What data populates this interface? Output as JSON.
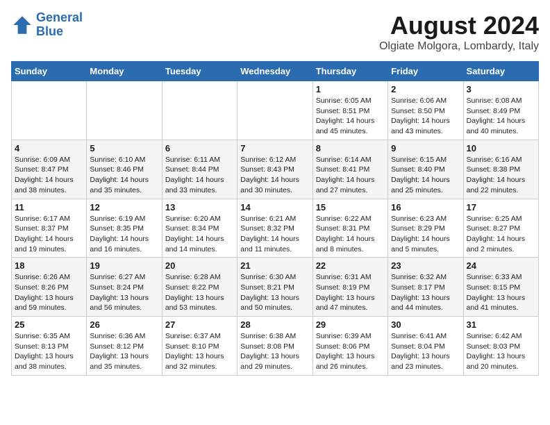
{
  "header": {
    "logo_line1": "General",
    "logo_line2": "Blue",
    "title": "August 2024",
    "subtitle": "Olgiate Molgora, Lombardy, Italy"
  },
  "weekdays": [
    "Sunday",
    "Monday",
    "Tuesday",
    "Wednesday",
    "Thursday",
    "Friday",
    "Saturday"
  ],
  "weeks": [
    [
      {
        "day": "",
        "detail": ""
      },
      {
        "day": "",
        "detail": ""
      },
      {
        "day": "",
        "detail": ""
      },
      {
        "day": "",
        "detail": ""
      },
      {
        "day": "1",
        "detail": "Sunrise: 6:05 AM\nSunset: 8:51 PM\nDaylight: 14 hours and 45 minutes."
      },
      {
        "day": "2",
        "detail": "Sunrise: 6:06 AM\nSunset: 8:50 PM\nDaylight: 14 hours and 43 minutes."
      },
      {
        "day": "3",
        "detail": "Sunrise: 6:08 AM\nSunset: 8:49 PM\nDaylight: 14 hours and 40 minutes."
      }
    ],
    [
      {
        "day": "4",
        "detail": "Sunrise: 6:09 AM\nSunset: 8:47 PM\nDaylight: 14 hours and 38 minutes."
      },
      {
        "day": "5",
        "detail": "Sunrise: 6:10 AM\nSunset: 8:46 PM\nDaylight: 14 hours and 35 minutes."
      },
      {
        "day": "6",
        "detail": "Sunrise: 6:11 AM\nSunset: 8:44 PM\nDaylight: 14 hours and 33 minutes."
      },
      {
        "day": "7",
        "detail": "Sunrise: 6:12 AM\nSunset: 8:43 PM\nDaylight: 14 hours and 30 minutes."
      },
      {
        "day": "8",
        "detail": "Sunrise: 6:14 AM\nSunset: 8:41 PM\nDaylight: 14 hours and 27 minutes."
      },
      {
        "day": "9",
        "detail": "Sunrise: 6:15 AM\nSunset: 8:40 PM\nDaylight: 14 hours and 25 minutes."
      },
      {
        "day": "10",
        "detail": "Sunrise: 6:16 AM\nSunset: 8:38 PM\nDaylight: 14 hours and 22 minutes."
      }
    ],
    [
      {
        "day": "11",
        "detail": "Sunrise: 6:17 AM\nSunset: 8:37 PM\nDaylight: 14 hours and 19 minutes."
      },
      {
        "day": "12",
        "detail": "Sunrise: 6:19 AM\nSunset: 8:35 PM\nDaylight: 14 hours and 16 minutes."
      },
      {
        "day": "13",
        "detail": "Sunrise: 6:20 AM\nSunset: 8:34 PM\nDaylight: 14 hours and 14 minutes."
      },
      {
        "day": "14",
        "detail": "Sunrise: 6:21 AM\nSunset: 8:32 PM\nDaylight: 14 hours and 11 minutes."
      },
      {
        "day": "15",
        "detail": "Sunrise: 6:22 AM\nSunset: 8:31 PM\nDaylight: 14 hours and 8 minutes."
      },
      {
        "day": "16",
        "detail": "Sunrise: 6:23 AM\nSunset: 8:29 PM\nDaylight: 14 hours and 5 minutes."
      },
      {
        "day": "17",
        "detail": "Sunrise: 6:25 AM\nSunset: 8:27 PM\nDaylight: 14 hours and 2 minutes."
      }
    ],
    [
      {
        "day": "18",
        "detail": "Sunrise: 6:26 AM\nSunset: 8:26 PM\nDaylight: 13 hours and 59 minutes."
      },
      {
        "day": "19",
        "detail": "Sunrise: 6:27 AM\nSunset: 8:24 PM\nDaylight: 13 hours and 56 minutes."
      },
      {
        "day": "20",
        "detail": "Sunrise: 6:28 AM\nSunset: 8:22 PM\nDaylight: 13 hours and 53 minutes."
      },
      {
        "day": "21",
        "detail": "Sunrise: 6:30 AM\nSunset: 8:21 PM\nDaylight: 13 hours and 50 minutes."
      },
      {
        "day": "22",
        "detail": "Sunrise: 6:31 AM\nSunset: 8:19 PM\nDaylight: 13 hours and 47 minutes."
      },
      {
        "day": "23",
        "detail": "Sunrise: 6:32 AM\nSunset: 8:17 PM\nDaylight: 13 hours and 44 minutes."
      },
      {
        "day": "24",
        "detail": "Sunrise: 6:33 AM\nSunset: 8:15 PM\nDaylight: 13 hours and 41 minutes."
      }
    ],
    [
      {
        "day": "25",
        "detail": "Sunrise: 6:35 AM\nSunset: 8:13 PM\nDaylight: 13 hours and 38 minutes."
      },
      {
        "day": "26",
        "detail": "Sunrise: 6:36 AM\nSunset: 8:12 PM\nDaylight: 13 hours and 35 minutes."
      },
      {
        "day": "27",
        "detail": "Sunrise: 6:37 AM\nSunset: 8:10 PM\nDaylight: 13 hours and 32 minutes."
      },
      {
        "day": "28",
        "detail": "Sunrise: 6:38 AM\nSunset: 8:08 PM\nDaylight: 13 hours and 29 minutes."
      },
      {
        "day": "29",
        "detail": "Sunrise: 6:39 AM\nSunset: 8:06 PM\nDaylight: 13 hours and 26 minutes."
      },
      {
        "day": "30",
        "detail": "Sunrise: 6:41 AM\nSunset: 8:04 PM\nDaylight: 13 hours and 23 minutes."
      },
      {
        "day": "31",
        "detail": "Sunrise: 6:42 AM\nSunset: 8:03 PM\nDaylight: 13 hours and 20 minutes."
      }
    ]
  ]
}
